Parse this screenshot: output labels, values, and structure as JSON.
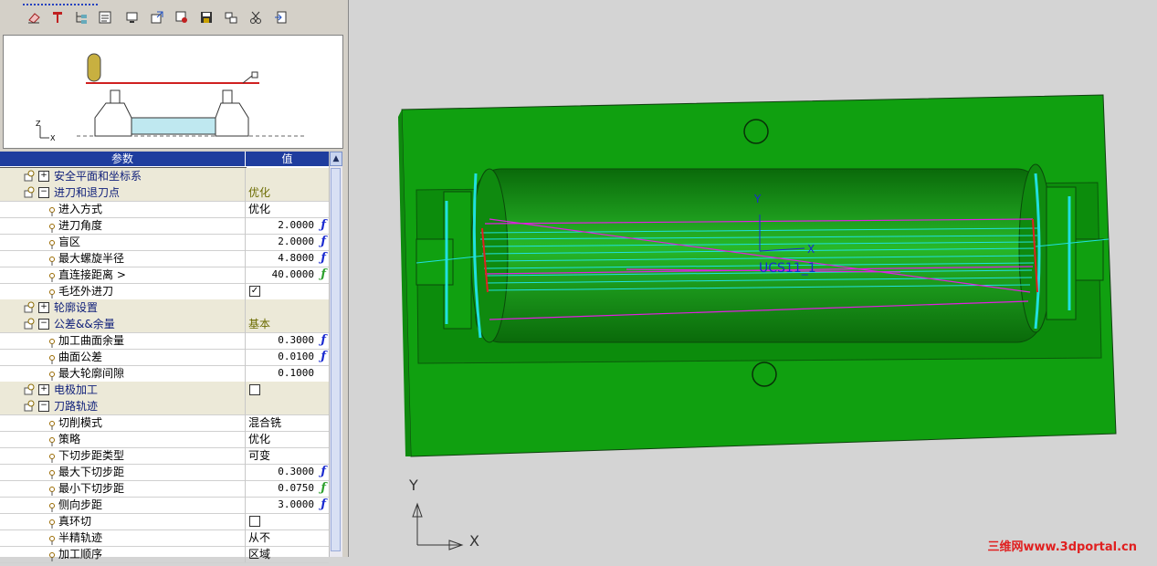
{
  "grid": {
    "headers": {
      "param": "参数",
      "value": "值"
    },
    "rows": [
      {
        "kind": "group",
        "sign": "+",
        "label": "安全平面和坐标系",
        "value": ""
      },
      {
        "kind": "group",
        "sign": "−",
        "label": "进刀和退刀点",
        "value": "优化"
      },
      {
        "kind": "item",
        "label": "进入方式",
        "value": "优化"
      },
      {
        "kind": "item",
        "label": "进刀角度",
        "value": "2.0000",
        "fn": "blue"
      },
      {
        "kind": "item",
        "label": "盲区",
        "value": "2.0000",
        "fn": "blue"
      },
      {
        "kind": "item",
        "label": "最大螺旋半径",
        "value": "4.8000",
        "fn": "blue"
      },
      {
        "kind": "item",
        "label": "直连接距离 >",
        "value": "40.0000",
        "fn": "green"
      },
      {
        "kind": "item",
        "label": "毛坯外进刀",
        "check": true
      },
      {
        "kind": "group",
        "sign": "+",
        "label": "轮廓设置",
        "value": ""
      },
      {
        "kind": "group",
        "sign": "−",
        "label": "公差&&余量",
        "value": "基本"
      },
      {
        "kind": "item",
        "label": "加工曲面余量",
        "value": "0.3000",
        "fn": "blue"
      },
      {
        "kind": "item",
        "label": "曲面公差",
        "value": "0.0100",
        "fn": "blue"
      },
      {
        "kind": "item",
        "label": "最大轮廓间隙",
        "value": "0.1000"
      },
      {
        "kind": "group",
        "sign": "+",
        "label": "电极加工",
        "check": false
      },
      {
        "kind": "group",
        "sign": "−",
        "label": "刀路轨迹",
        "value": ""
      },
      {
        "kind": "item",
        "label": "切削模式",
        "value": "混合铣"
      },
      {
        "kind": "item",
        "label": "策略",
        "value": "优化"
      },
      {
        "kind": "item",
        "label": "下切步距类型",
        "value": "可变"
      },
      {
        "kind": "item",
        "label": "最大下切步距",
        "value": "0.3000",
        "fn": "blue"
      },
      {
        "kind": "item",
        "label": "最小下切步距",
        "value": "0.0750",
        "fn": "green"
      },
      {
        "kind": "item",
        "label": "侧向步距",
        "value": "3.0000",
        "fn": "blue"
      },
      {
        "kind": "item",
        "label": "真环切",
        "check": false
      },
      {
        "kind": "item",
        "label": "半精轨迹",
        "value": "从不"
      },
      {
        "kind": "item",
        "label": "加工顺序",
        "value": "区域"
      }
    ]
  },
  "preview": {
    "axis_z": "Z",
    "axis_x": "X"
  },
  "viewport": {
    "ucs_label": "UCS11_1",
    "ucs_y": "Y",
    "ucs_x": "X",
    "triad_y": "Y",
    "triad_x": "X",
    "colors": {
      "part": "#1fa81f",
      "toolpath_cyan": "#20e0e0",
      "toolpath_magenta": "#e020e0",
      "toolpath_red": "#e02020"
    }
  },
  "watermark": "三维网www.3dportal.cn",
  "toolbar_icons": [
    "eraser-icon",
    "tool-icon",
    "tree-icon",
    "list-icon",
    "monitor-icon",
    "export-icon",
    "data-icon",
    "save-icon",
    "link-icon",
    "cut-icon",
    "exit-icon"
  ]
}
